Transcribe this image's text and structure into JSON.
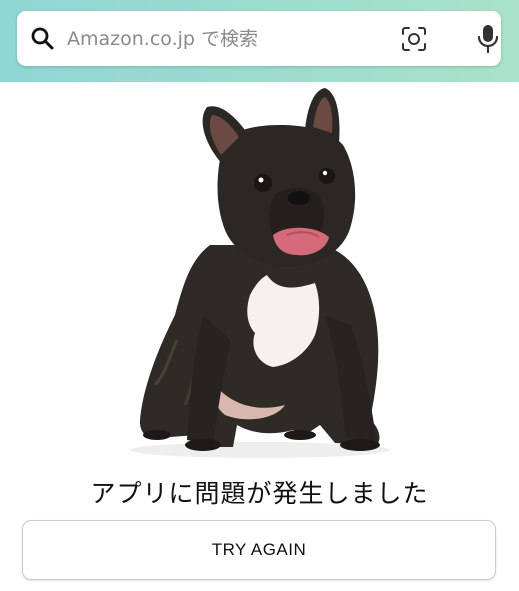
{
  "search": {
    "placeholder": "Amazon.co.jp で検索",
    "value": ""
  },
  "icons": {
    "search": "search-icon",
    "camera": "camera-scan-icon",
    "microphone": "microphone-icon"
  },
  "error": {
    "message": "アプリに問題が発生しました",
    "image": "french-bulldog-illustration"
  },
  "actions": {
    "try_again_label": "TRY AGAIN"
  },
  "colors": {
    "header_gradient_start": "#8fd6d4",
    "header_gradient_end": "#a9e2c9",
    "button_border": "#c9cbcc"
  }
}
